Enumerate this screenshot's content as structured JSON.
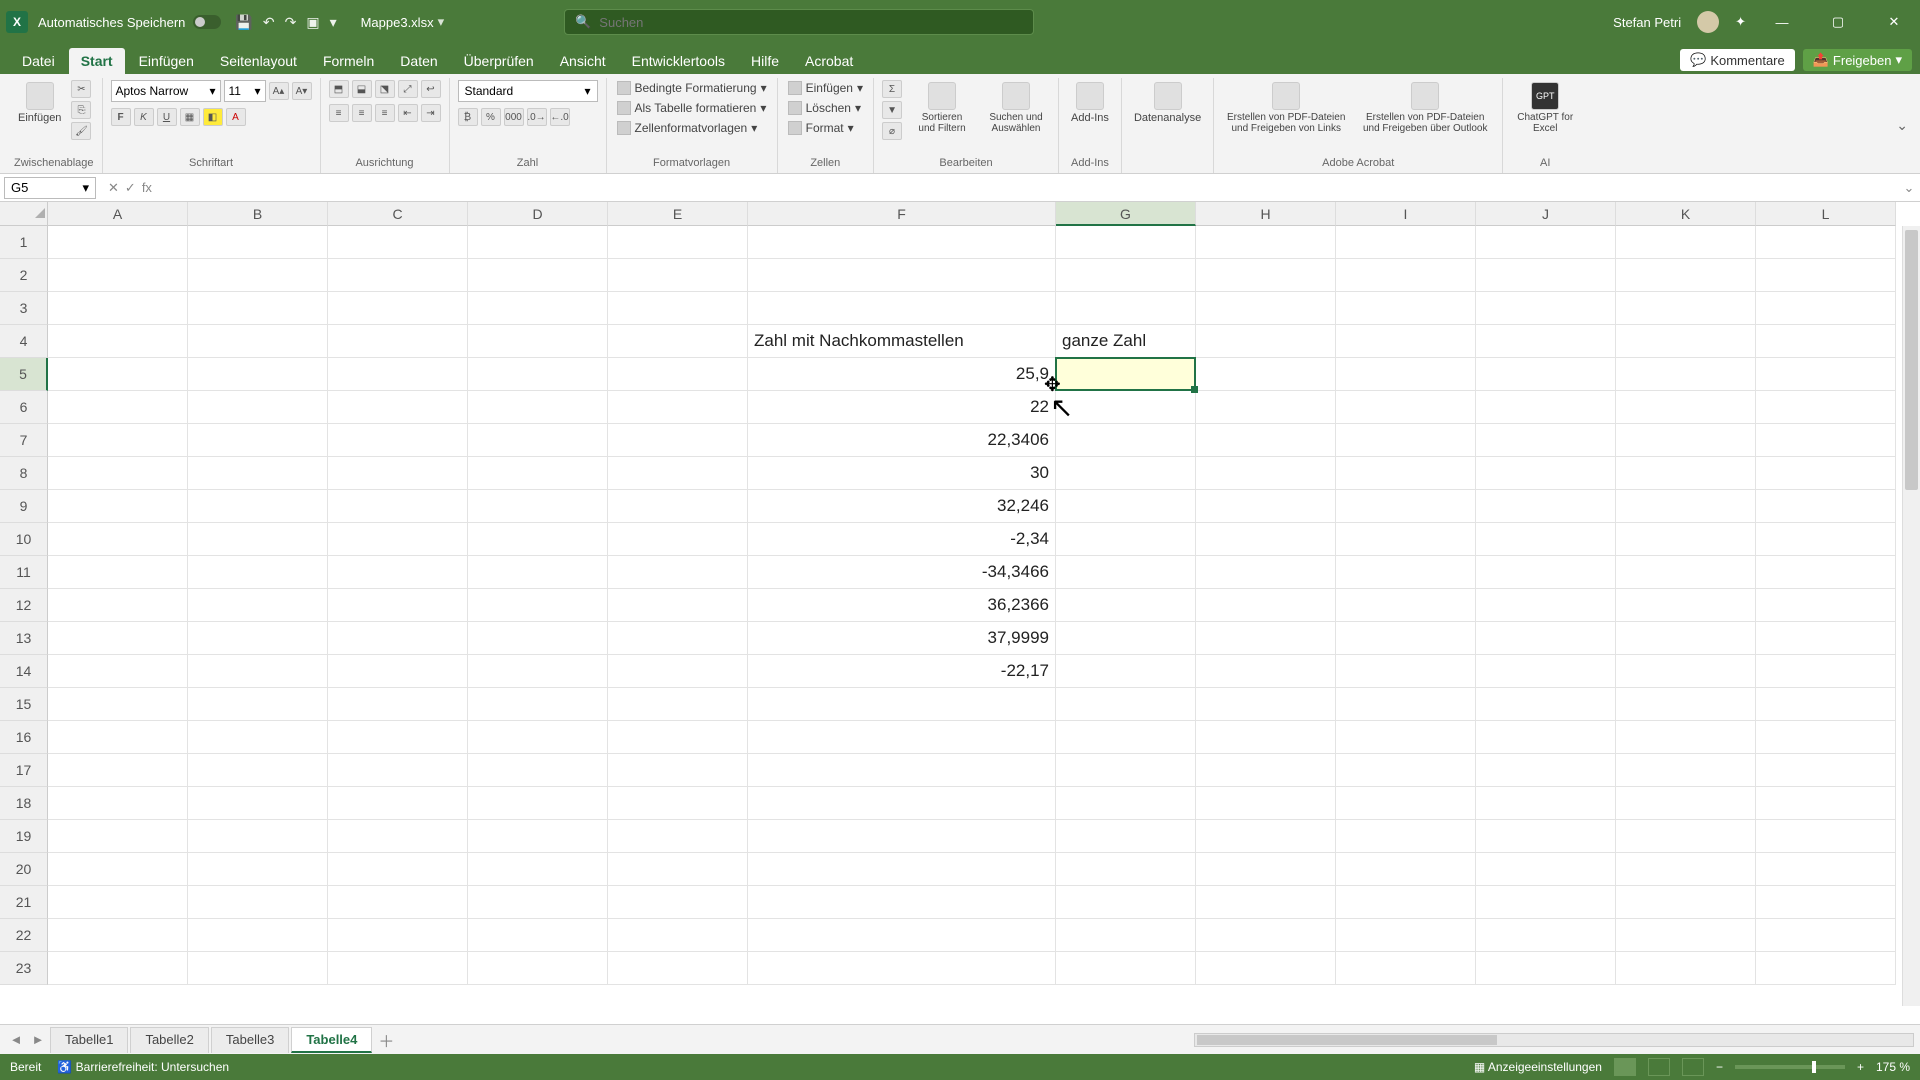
{
  "titlebar": {
    "autosave_label": "Automatisches Speichern",
    "filename": "Mappe3.xlsx",
    "search_placeholder": "Suchen",
    "username": "Stefan Petri"
  },
  "menu": {
    "tabs": [
      "Datei",
      "Start",
      "Einfügen",
      "Seitenlayout",
      "Formeln",
      "Daten",
      "Überprüfen",
      "Ansicht",
      "Entwicklertools",
      "Hilfe",
      "Acrobat"
    ],
    "active_index": 1,
    "comments": "Kommentare",
    "share": "Freigeben"
  },
  "ribbon": {
    "clipboard": {
      "paste": "Einfügen",
      "label": "Zwischenablage"
    },
    "font": {
      "name": "Aptos Narrow",
      "size": "11",
      "label": "Schriftart"
    },
    "align": {
      "label": "Ausrichtung"
    },
    "number": {
      "format": "Standard",
      "label": "Zahl"
    },
    "styles": {
      "cond": "Bedingte Formatierung",
      "table": "Als Tabelle formatieren",
      "cell": "Zellenformatvorlagen",
      "label": "Formatvorlagen"
    },
    "cellsg": {
      "insert": "Einfügen",
      "delete": "Löschen",
      "format": "Format",
      "label": "Zellen"
    },
    "editing": {
      "sort": "Sortieren und Filtern",
      "find": "Suchen und Auswählen",
      "label": "Bearbeiten"
    },
    "addins": {
      "btn": "Add-Ins",
      "label": "Add-Ins"
    },
    "analysis": {
      "btn": "Datenanalyse"
    },
    "acrobat": {
      "pdf1": "Erstellen von PDF-Dateien und Freigeben von Links",
      "pdf2": "Erstellen von PDF-Dateien und Freigeben über Outlook",
      "label": "Adobe Acrobat"
    },
    "ai": {
      "btn": "ChatGPT for Excel",
      "label": "AI"
    }
  },
  "formula": {
    "namebox": "G5",
    "fx": "fx",
    "value": ""
  },
  "grid": {
    "columns": [
      "A",
      "B",
      "C",
      "D",
      "E",
      "F",
      "G",
      "H",
      "I",
      "J",
      "K",
      "L"
    ],
    "col_widths": {
      "F": 308
    },
    "selected_col_index": 6,
    "selected_row_index": 4,
    "rowcount": 23,
    "cells": {
      "F4": "Zahl mit Nachkommastellen",
      "G4": "ganze Zahl",
      "F5": "25,9",
      "F6": "22",
      "F7": "22,3406",
      "F8": "30",
      "F9": "32,246",
      "F10": "-2,34",
      "F11": "-34,3466",
      "F12": "36,2366",
      "F13": "37,9999",
      "F14": "-22,17"
    },
    "active_cell": "G5"
  },
  "sheets": {
    "tabs": [
      "Tabelle1",
      "Tabelle2",
      "Tabelle3",
      "Tabelle4"
    ],
    "active_index": 3
  },
  "status": {
    "ready": "Bereit",
    "access": "Barrierefreiheit: Untersuchen",
    "display": "Anzeigeeinstellungen",
    "zoom": "175 %"
  }
}
